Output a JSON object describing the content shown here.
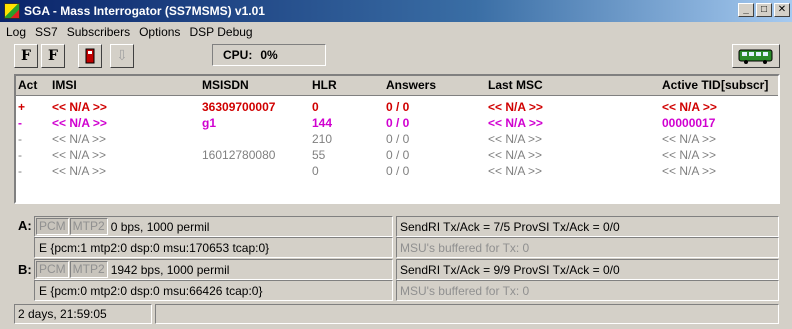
{
  "window": {
    "title": "SGA - Mass Interrogator (SS7MSMS) v1.01",
    "controls": [
      "_",
      "□",
      "✕"
    ]
  },
  "menu": [
    "Log",
    "SS7",
    "Subscribers",
    "Options",
    "DSP Debug"
  ],
  "toolbar": {
    "buttons": [
      {
        "name": "f-start-button",
        "glyph": "F"
      },
      {
        "name": "f-stop-button",
        "glyph": "F"
      },
      {
        "name": "signal-button",
        "glyph": "▮"
      },
      {
        "name": "import-button",
        "glyph": "⇩"
      }
    ],
    "cpu_label": "CPU:",
    "cpu_value": "0%"
  },
  "table": {
    "columns": [
      "Act",
      "IMSI",
      "MSISDN",
      "HLR",
      "Answers",
      "Last MSC",
      "Active TID",
      "[subscr]"
    ],
    "rows": [
      {
        "act": "+",
        "imsi": "<< N/A >>",
        "msisdn": "36309700007",
        "hlr": "0",
        "answers": "0 / 0",
        "last_msc": "<< N/A >>",
        "tid": "<< N/A >>",
        "color": "#d00000",
        "style": "bold"
      },
      {
        "act": "-",
        "imsi": "<< N/A >>",
        "msisdn": "g1",
        "hlr": "144",
        "answers": "0 / 0",
        "last_msc": "<< N/A >>",
        "tid": "00000017",
        "color": "#d000d0",
        "style": "bold"
      },
      {
        "act": "-",
        "imsi": "<< N/A >>",
        "msisdn": "",
        "hlr": "210",
        "answers": "0 / 0",
        "last_msc": "<< N/A >>",
        "tid": "<< N/A >>",
        "color": "#808080",
        "style": "normal"
      },
      {
        "act": "-",
        "imsi": "<< N/A >>",
        "msisdn": "16012780080",
        "hlr": "55",
        "answers": "0 / 0",
        "last_msc": "<< N/A >>",
        "tid": "<< N/A >>",
        "color": "#808080",
        "style": "normal"
      },
      {
        "act": "-",
        "imsi": "<< N/A >>",
        "msisdn": "",
        "hlr": "0",
        "answers": "0 / 0",
        "last_msc": "<< N/A >>",
        "tid": "<< N/A >>",
        "color": "#808080",
        "style": "normal"
      }
    ]
  },
  "links": [
    {
      "label": "A:",
      "pcm": "PCM",
      "mtp2": "MTP2",
      "rate": "0 bps, 1000 permil",
      "detail": "E {pcm:1  mtp2:0  dsp:0  msu:170653  tcap:0}",
      "send": "SendRI Tx/Ack = 7/5   ProvSI Tx/Ack = 0/0",
      "buffered": "MSU's buffered for Tx: 0"
    },
    {
      "label": "B:",
      "pcm": "PCM",
      "mtp2": "MTP2",
      "rate": "1942 bps, 1000 permil",
      "detail": "E {pcm:0  mtp2:0  dsp:0  msu:66426  tcap:0}",
      "send": "SendRI Tx/Ack = 9/9   ProvSI Tx/Ack = 0/0",
      "buffered": "MSU's buffered for Tx: 0"
    }
  ],
  "status": {
    "uptime": "2 days, 21:59:05",
    "message": ""
  },
  "colors": {
    "title_start": "#0a246a",
    "title_end": "#a6caf0",
    "bus_green": "#2a8a2a",
    "signal_red": "#c00000"
  }
}
